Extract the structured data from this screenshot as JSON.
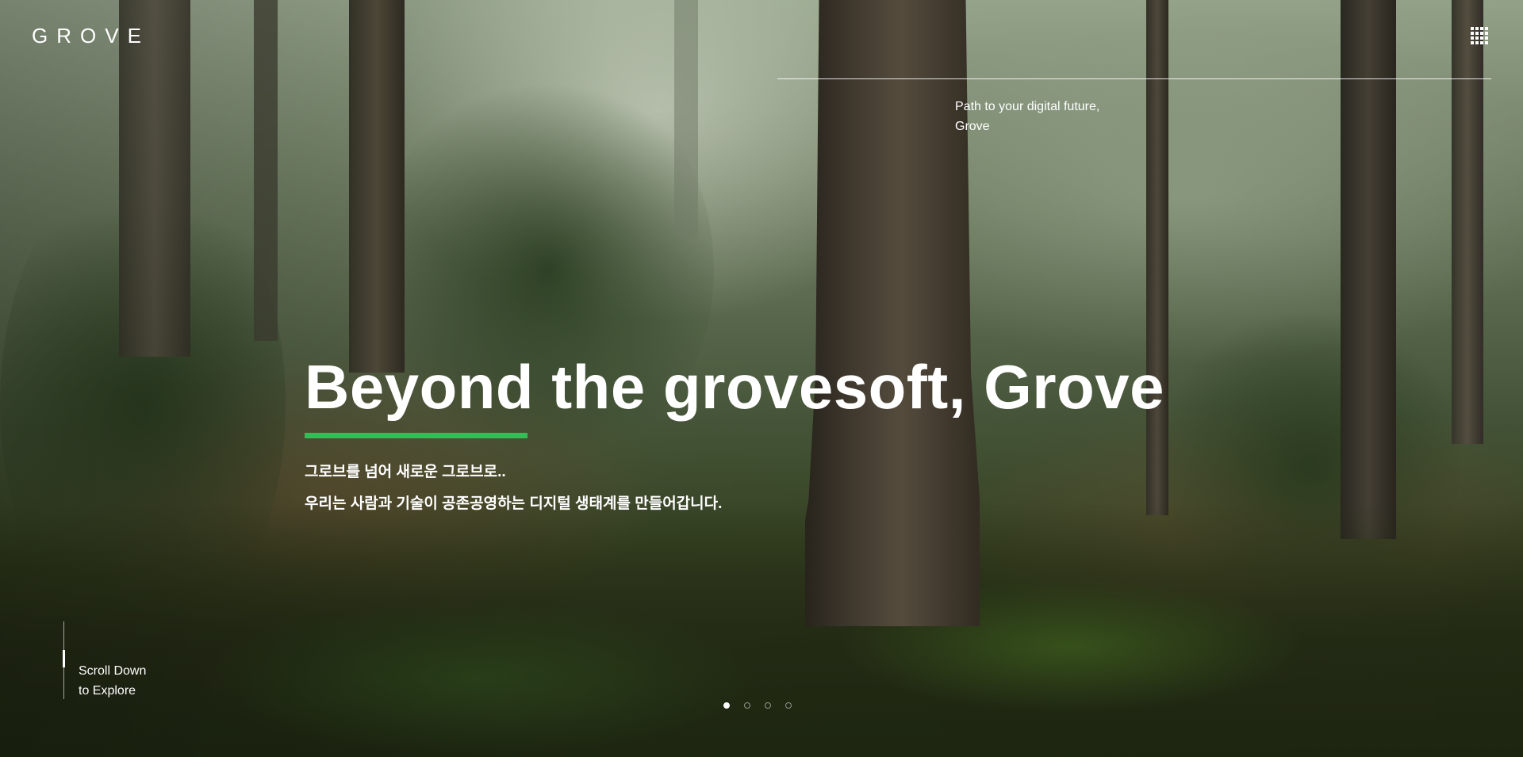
{
  "header": {
    "logo_text": "GROVE",
    "menu_icon": "grid-menu-icon",
    "tagline_line1": "Path to your digital future,",
    "tagline_line2": "Grove"
  },
  "hero": {
    "headline": "Beyond the grovesoft, Grove",
    "subtitle_1": "그로브를 넘어 새로운 그로브로..",
    "subtitle_2": "우리는 사람과 기술이 공존공영하는 디지털 생태계를 만들어갑니다.",
    "accent_color": "#2bc157"
  },
  "scroll_hint": {
    "line1": "Scroll Down",
    "line2": "to Explore"
  },
  "pagination": {
    "total": 4,
    "active_index": 0
  }
}
